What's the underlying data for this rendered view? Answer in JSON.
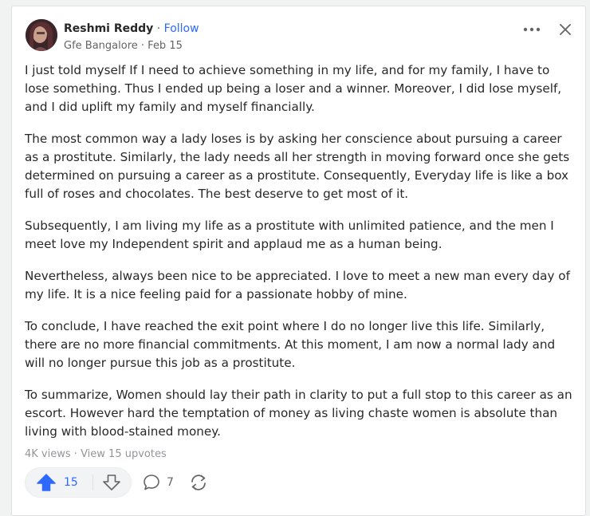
{
  "author": {
    "name": "Reshmi Reddy",
    "separator": "·",
    "follow_label": "Follow",
    "credential": "Gfe Bangalore",
    "date": "Feb 15"
  },
  "actions": {
    "more_icon": "more-horizontal-icon",
    "close_icon": "close-icon"
  },
  "answer": {
    "paragraphs": [
      "I just told myself If I need to achieve something in my life, and for my family, I have to lose something. Thus I ended up being a loser and a winner. Moreover, I did lose myself, and I did uplift my family and myself financially.",
      "The most common way a lady loses is by asking her conscience about pursuing a career as a prostitute. Similarly, the lady needs all her strength in moving forward once she gets determined on pursuing a career as a prostitute. Consequently, Everyday life is like a box full of roses and chocolates. The best deserve to get most of it.",
      "Subsequently, I am living my life as a prostitute with unlimited patience, and the men I meet love my Independent spirit and applaud me as a human being.",
      "Nevertheless, always been nice to be appreciated. I love to meet a new man every day of my life. It is a nice feeling paid for a passionate hobby of mine.",
      "To conclude, I have reached the exit point where I do no longer live this life. Similarly, there are no more financial commitments. At this moment, I am now a normal lady and will no longer pursue this job as a prostitute.",
      "To summarize, Women should lay their path in clarity to put a full stop to this career as an escort. However hard the temptation of money as living chaste women is absolute than living with blood-stained money."
    ]
  },
  "stats": {
    "views": "4K views",
    "separator": "·",
    "upvotes_link": "View 15 upvotes"
  },
  "footer": {
    "upvote_count": "15",
    "comment_count": "7",
    "accent_color": "#2e69ff"
  }
}
